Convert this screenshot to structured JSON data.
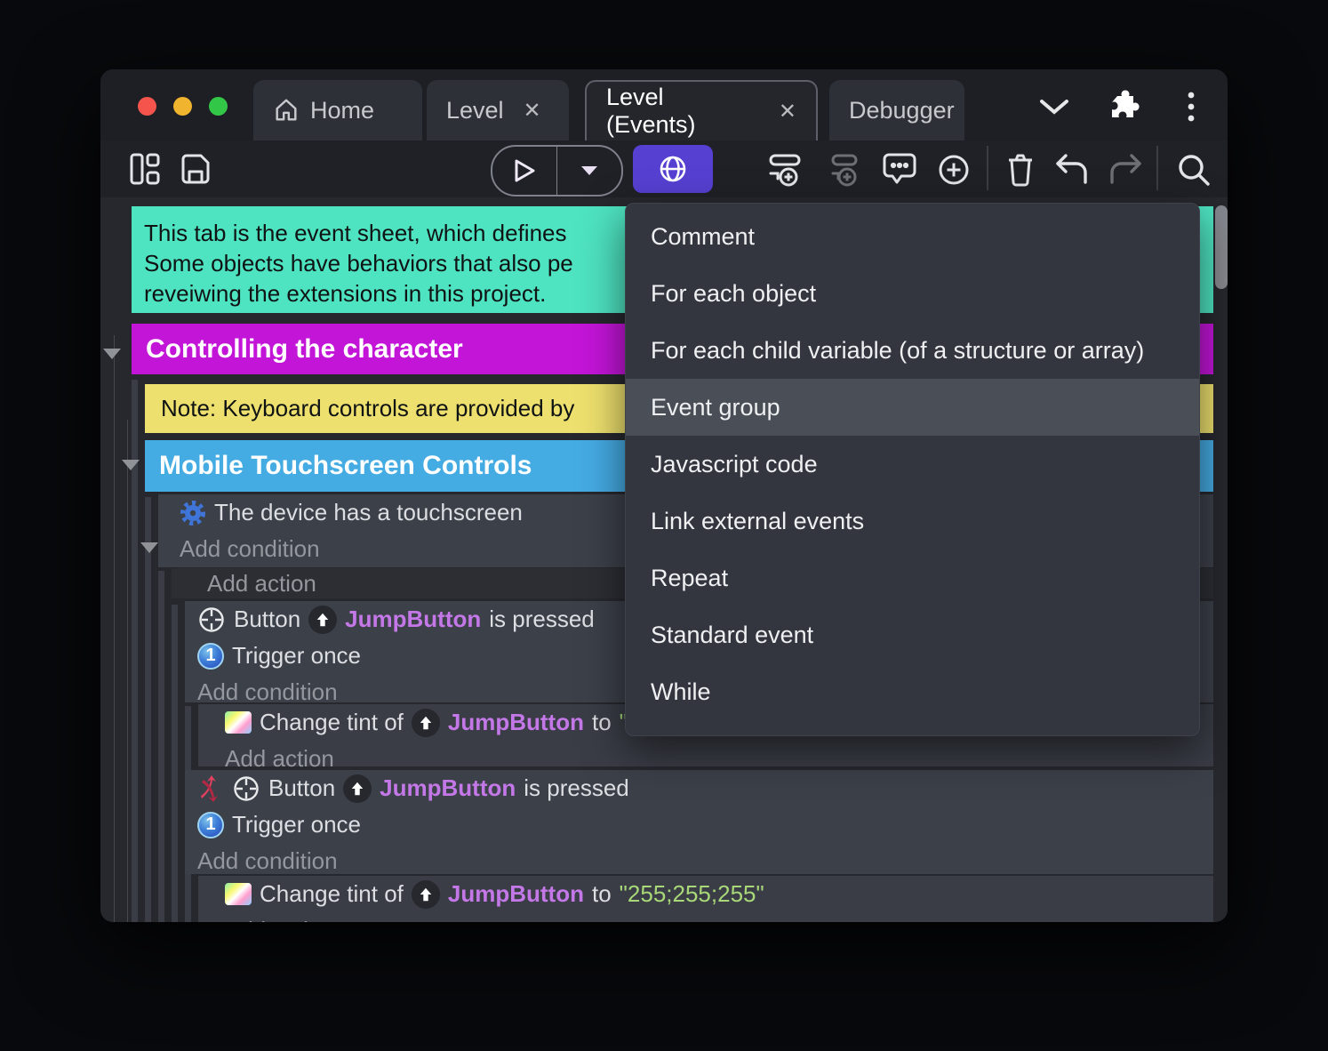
{
  "colors": {
    "accent_purple": "#5640d2",
    "comment_green": "#4ee3c1",
    "group_magenta": "#c315d8",
    "note_yellow": "#eee06e",
    "group_blue": "#45abe3",
    "object_name_purple": "#c478e8",
    "string_green": "#a8d878",
    "menu_bg": "#33363f",
    "menu_highlight": "#4a4e57",
    "traffic_red": "#f4544c",
    "traffic_yellow": "#f0b42e",
    "traffic_green": "#33c748"
  },
  "titlebar": {
    "tabs": [
      {
        "label": "Home"
      },
      {
        "label": "Level",
        "close_glyph": "✕"
      },
      {
        "label": "Level (Events)",
        "close_glyph": "✕"
      },
      {
        "label": "Debugger"
      }
    ]
  },
  "menu": {
    "highlighted": "Event group",
    "items": [
      {
        "label": "Comment"
      },
      {
        "label": "For each object"
      },
      {
        "label": "For each child variable (of a structure or array)"
      },
      {
        "label": "Event group"
      },
      {
        "label": "Javascript code"
      },
      {
        "label": "Link external events"
      },
      {
        "label": "Repeat"
      },
      {
        "label": "Standard event"
      },
      {
        "label": "While"
      }
    ]
  },
  "sheet": {
    "comment_line1": "This tab is the event sheet, which defines",
    "comment_line2": "Some objects have behaviors that also pe",
    "comment_line3": "reveiwing the extensions in this project.",
    "group_controlling": "Controlling the character",
    "note_keyboard": "Note: Keyboard controls are provided by",
    "group_mobile": "Mobile Touchscreen Controls",
    "labels": {
      "touchscreen": "The device has a touchscreen",
      "add_condition": "Add condition",
      "add_action": "Add action",
      "button": "Button",
      "jump_button": "JumpButton",
      "is_pressed": "is pressed",
      "trigger_once": "Trigger once",
      "change_tint_of": "Change tint of",
      "to": "to",
      "tint_value": "\"255;255;255\""
    }
  }
}
